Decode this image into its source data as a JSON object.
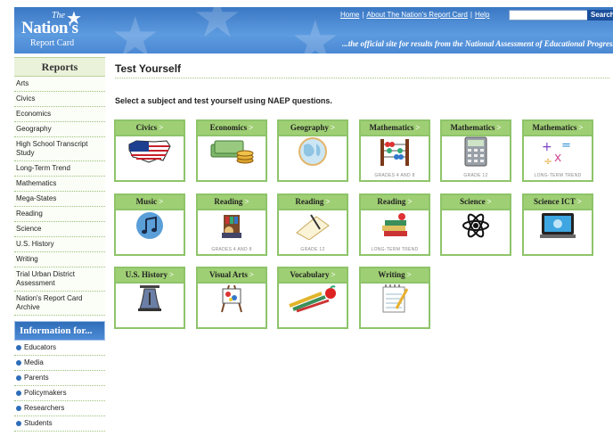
{
  "header": {
    "logo_the": "The",
    "logo_nations": "Nation's",
    "logo_report_card": "Report Card",
    "links": [
      "Home",
      "About The Nation's Report Card",
      "Help"
    ],
    "search_button": "Search",
    "tagline": "...the official site for results from the National Assessment of Educational Progress"
  },
  "sidebar": {
    "reports_title": "Reports",
    "items": [
      "Arts",
      "Civics",
      "Economics",
      "Geography",
      "High School Transcript Study",
      "Long-Term Trend",
      "Mathematics",
      "Mega-States",
      "Reading",
      "Science",
      "U.S. History",
      "Writing",
      "Trial Urban District Assessment",
      "Nation's Report Card Archive"
    ],
    "info_title": "Information for...",
    "info_items": [
      "Educators",
      "Media",
      "Parents",
      "Policymakers",
      "Researchers",
      "Students"
    ]
  },
  "main": {
    "title": "Test Yourself",
    "intro": "Select a subject and test yourself using NAEP questions.",
    "tiles": [
      {
        "label": "Civics",
        "sub": "",
        "icon": "us-map-icon"
      },
      {
        "label": "Economics",
        "sub": "",
        "icon": "money-icon"
      },
      {
        "label": "Geography",
        "sub": "",
        "icon": "globe-icon"
      },
      {
        "label": "Mathematics",
        "sub": "GRADES 4 AND 8",
        "icon": "abacus-icon"
      },
      {
        "label": "Mathematics",
        "sub": "GRADE 12",
        "icon": "calculator-icon"
      },
      {
        "label": "Mathematics",
        "sub": "LONG-TERM TREND",
        "icon": "math-symbols-icon"
      },
      {
        "label": "Music",
        "sub": "",
        "icon": "music-note-icon"
      },
      {
        "label": "Reading",
        "sub": "GRADES 4 AND 8",
        "icon": "reader-icon"
      },
      {
        "label": "Reading",
        "sub": "GRADE 12",
        "icon": "paper-pen-icon"
      },
      {
        "label": "Reading",
        "sub": "LONG-TERM TREND",
        "icon": "book-stack-icon"
      },
      {
        "label": "Science",
        "sub": "",
        "icon": "atom-icon"
      },
      {
        "label": "Science ICT",
        "sub": "",
        "icon": "computer-icon"
      },
      {
        "label": "U.S. History",
        "sub": "",
        "icon": "liberty-bell-icon"
      },
      {
        "label": "Visual Arts",
        "sub": "",
        "icon": "paint-easel-icon"
      },
      {
        "label": "Vocabulary",
        "sub": "",
        "icon": "school-supplies-icon"
      },
      {
        "label": "Writing",
        "sub": "",
        "icon": "notepad-icon"
      }
    ]
  }
}
